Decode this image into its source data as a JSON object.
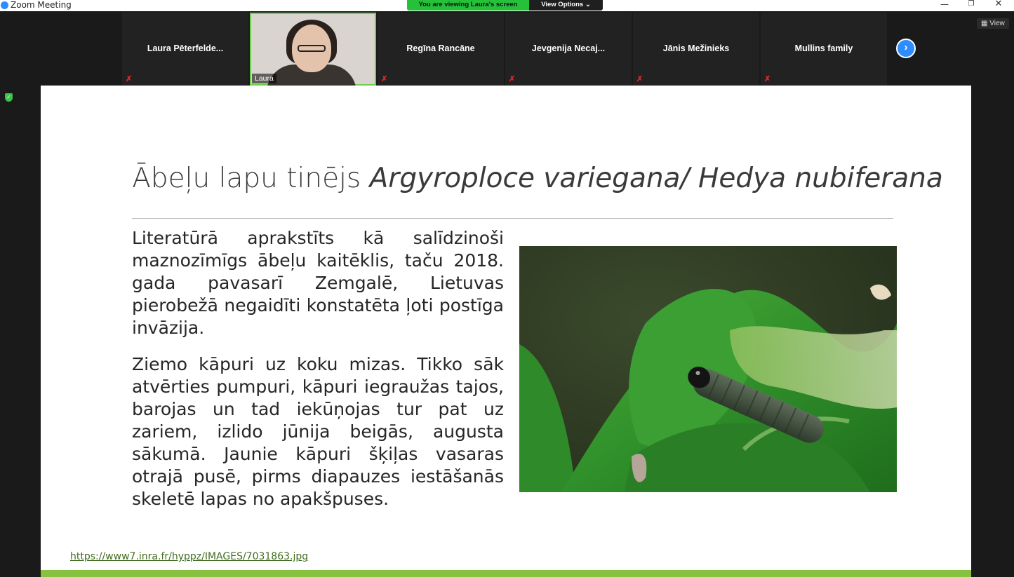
{
  "window": {
    "title": "Zoom Meeting"
  },
  "banner": {
    "viewing": "You are viewing Laura's screen",
    "options": "View Options ⌄"
  },
  "participants": [
    {
      "name": "Laura  Pēterfelde...",
      "muted": true
    },
    {
      "name": "Laura",
      "video": true
    },
    {
      "name": "Regīna Rancāne",
      "muted": true
    },
    {
      "name": "Jevgenija  Necaj...",
      "muted": true
    },
    {
      "name": "Jānis Mežinieks",
      "muted": true
    },
    {
      "name": "Mullins family",
      "muted": true
    }
  ],
  "view_button": "View",
  "slide": {
    "title_plain": "Ābeļu lapu tinējs ",
    "title_latin": "Argyroploce variegana/ Hedya nubiferana",
    "paragraph1": "Literatūrā aprakstīts kā salīdzinoši maznozīmīgs ābeļu kaitēklis, taču 2018. gada pavasarī Zemgalē, Lietuvas pierobežā negaidīti konstatēta ļoti postīga invāzija.",
    "paragraph2": "Ziemo kāpuri uz koku mizas. Tikko sāk atvērties pumpuri, kāpuri iegraužas tajos, barojas un tad iekūņojas tur pat uz zariem, izlido jūnija beigās, augusta sākumā. Jaunie kāpuri šķiļas vasaras otrajā pusē, pirms diapauzes iestāšanās skeletē lapas no apakšpuses.",
    "source_url": "https://www7.inra.fr/hyppz/IMAGES/7031863.jpg"
  },
  "colors": {
    "accent_green": "#86c23f",
    "zoom_blue": "#2d8cff",
    "mute_red": "#e02828"
  }
}
